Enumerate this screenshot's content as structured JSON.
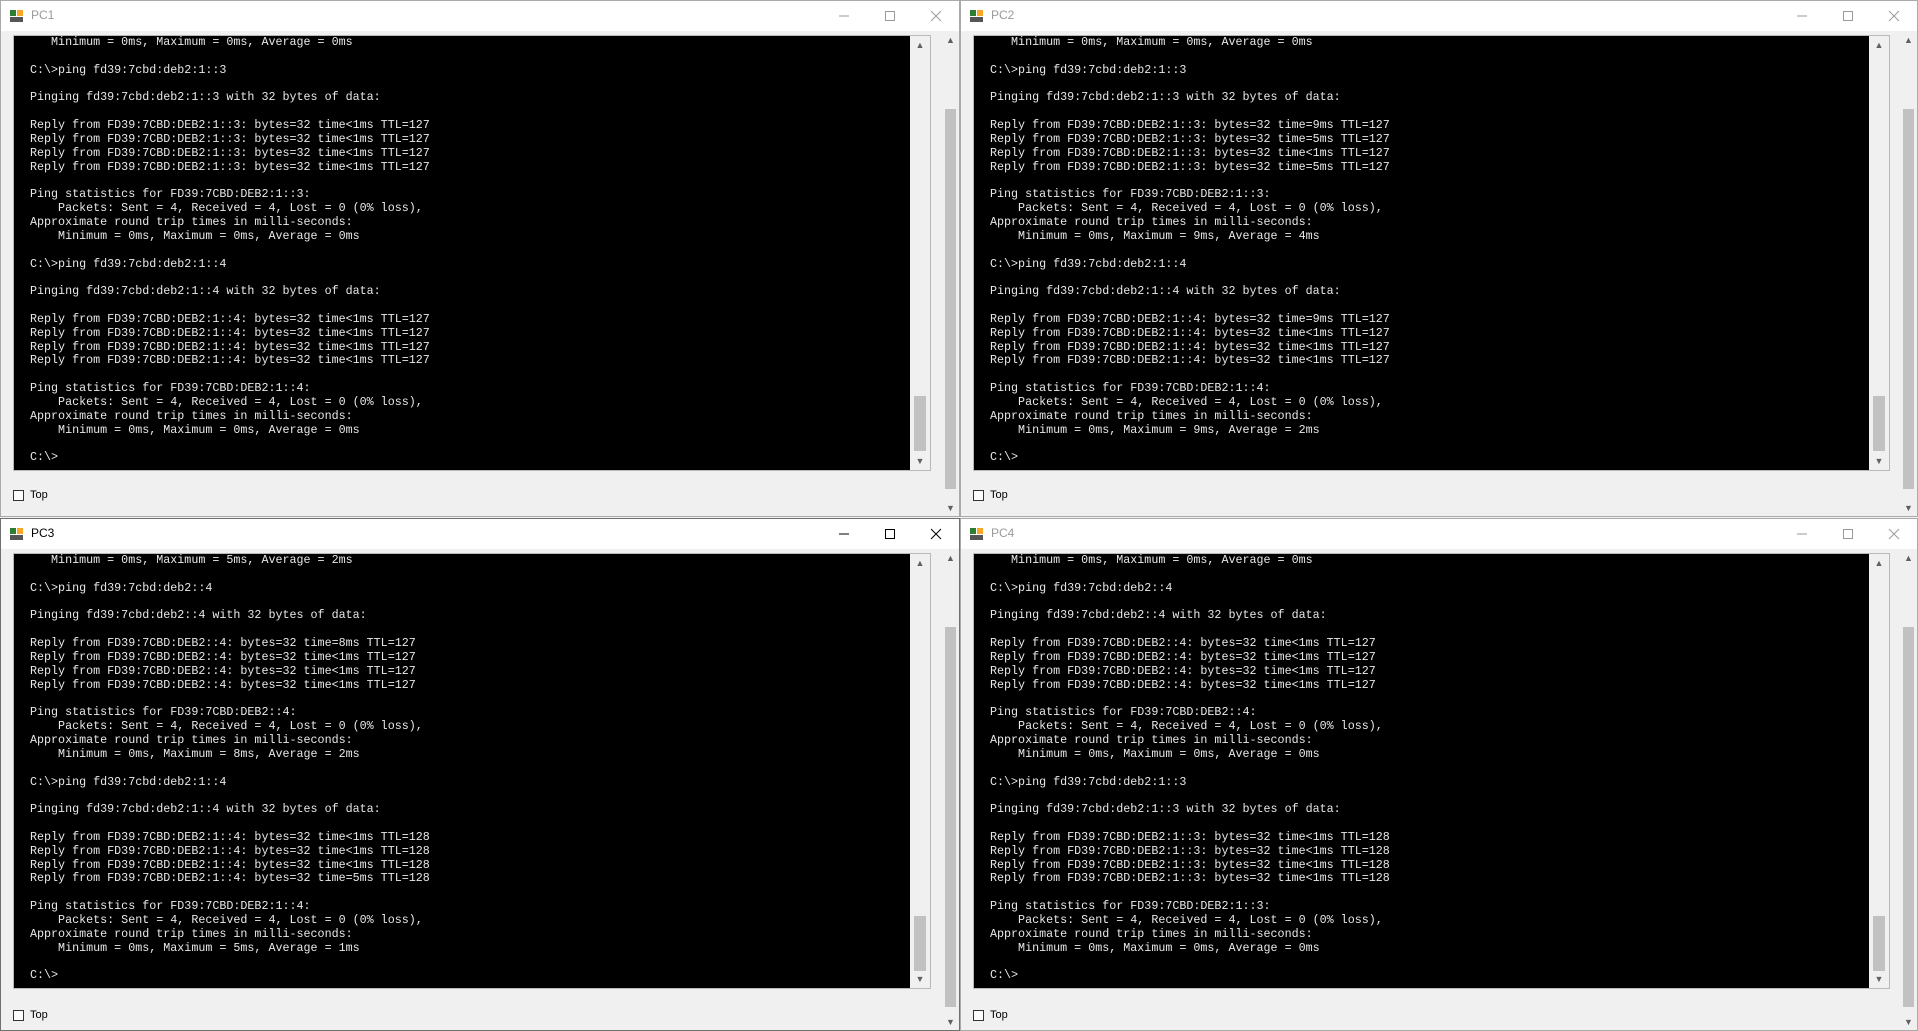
{
  "windows": [
    {
      "title": "PC1",
      "top_checkbox_label": "Top",
      "terminal_lines": [
        "   Minimum = 0ms, Maximum = 0ms, Average = 0ms",
        "",
        "C:\\>ping fd39:7cbd:deb2:1::3",
        "",
        "Pinging fd39:7cbd:deb2:1::3 with 32 bytes of data:",
        "",
        "Reply from FD39:7CBD:DEB2:1::3: bytes=32 time<1ms TTL=127",
        "Reply from FD39:7CBD:DEB2:1::3: bytes=32 time<1ms TTL=127",
        "Reply from FD39:7CBD:DEB2:1::3: bytes=32 time<1ms TTL=127",
        "Reply from FD39:7CBD:DEB2:1::3: bytes=32 time<1ms TTL=127",
        "",
        "Ping statistics for FD39:7CBD:DEB2:1::3:",
        "    Packets: Sent = 4, Received = 4, Lost = 0 (0% loss),",
        "Approximate round trip times in milli-seconds:",
        "    Minimum = 0ms, Maximum = 0ms, Average = 0ms",
        "",
        "C:\\>ping fd39:7cbd:deb2:1::4",
        "",
        "Pinging fd39:7cbd:deb2:1::4 with 32 bytes of data:",
        "",
        "Reply from FD39:7CBD:DEB2:1::4: bytes=32 time<1ms TTL=127",
        "Reply from FD39:7CBD:DEB2:1::4: bytes=32 time<1ms TTL=127",
        "Reply from FD39:7CBD:DEB2:1::4: bytes=32 time<1ms TTL=127",
        "Reply from FD39:7CBD:DEB2:1::4: bytes=32 time<1ms TTL=127",
        "",
        "Ping statistics for FD39:7CBD:DEB2:1::4:",
        "    Packets: Sent = 4, Received = 4, Lost = 0 (0% loss),",
        "Approximate round trip times in milli-seconds:",
        "    Minimum = 0ms, Maximum = 0ms, Average = 0ms",
        "",
        "C:\\>"
      ]
    },
    {
      "title": "PC2",
      "top_checkbox_label": "Top",
      "terminal_lines": [
        "   Minimum = 0ms, Maximum = 0ms, Average = 0ms",
        "",
        "C:\\>ping fd39:7cbd:deb2:1::3",
        "",
        "Pinging fd39:7cbd:deb2:1::3 with 32 bytes of data:",
        "",
        "Reply from FD39:7CBD:DEB2:1::3: bytes=32 time=9ms TTL=127",
        "Reply from FD39:7CBD:DEB2:1::3: bytes=32 time=5ms TTL=127",
        "Reply from FD39:7CBD:DEB2:1::3: bytes=32 time<1ms TTL=127",
        "Reply from FD39:7CBD:DEB2:1::3: bytes=32 time=5ms TTL=127",
        "",
        "Ping statistics for FD39:7CBD:DEB2:1::3:",
        "    Packets: Sent = 4, Received = 4, Lost = 0 (0% loss),",
        "Approximate round trip times in milli-seconds:",
        "    Minimum = 0ms, Maximum = 9ms, Average = 4ms",
        "",
        "C:\\>ping fd39:7cbd:deb2:1::4",
        "",
        "Pinging fd39:7cbd:deb2:1::4 with 32 bytes of data:",
        "",
        "Reply from FD39:7CBD:DEB2:1::4: bytes=32 time=9ms TTL=127",
        "Reply from FD39:7CBD:DEB2:1::4: bytes=32 time<1ms TTL=127",
        "Reply from FD39:7CBD:DEB2:1::4: bytes=32 time<1ms TTL=127",
        "Reply from FD39:7CBD:DEB2:1::4: bytes=32 time<1ms TTL=127",
        "",
        "Ping statistics for FD39:7CBD:DEB2:1::4:",
        "    Packets: Sent = 4, Received = 4, Lost = 0 (0% loss),",
        "Approximate round trip times in milli-seconds:",
        "    Minimum = 0ms, Maximum = 9ms, Average = 2ms",
        "",
        "C:\\>"
      ]
    },
    {
      "title": "PC3",
      "top_checkbox_label": "Top",
      "terminal_lines": [
        "   Minimum = 0ms, Maximum = 5ms, Average = 2ms",
        "",
        "C:\\>ping fd39:7cbd:deb2::4",
        "",
        "Pinging fd39:7cbd:deb2::4 with 32 bytes of data:",
        "",
        "Reply from FD39:7CBD:DEB2::4: bytes=32 time=8ms TTL=127",
        "Reply from FD39:7CBD:DEB2::4: bytes=32 time<1ms TTL=127",
        "Reply from FD39:7CBD:DEB2::4: bytes=32 time<1ms TTL=127",
        "Reply from FD39:7CBD:DEB2::4: bytes=32 time<1ms TTL=127",
        "",
        "Ping statistics for FD39:7CBD:DEB2::4:",
        "    Packets: Sent = 4, Received = 4, Lost = 0 (0% loss),",
        "Approximate round trip times in milli-seconds:",
        "    Minimum = 0ms, Maximum = 8ms, Average = 2ms",
        "",
        "C:\\>ping fd39:7cbd:deb2:1::4",
        "",
        "Pinging fd39:7cbd:deb2:1::4 with 32 bytes of data:",
        "",
        "Reply from FD39:7CBD:DEB2:1::4: bytes=32 time<1ms TTL=128",
        "Reply from FD39:7CBD:DEB2:1::4: bytes=32 time<1ms TTL=128",
        "Reply from FD39:7CBD:DEB2:1::4: bytes=32 time<1ms TTL=128",
        "Reply from FD39:7CBD:DEB2:1::4: bytes=32 time=5ms TTL=128",
        "",
        "Ping statistics for FD39:7CBD:DEB2:1::4:",
        "    Packets: Sent = 4, Received = 4, Lost = 0 (0% loss),",
        "Approximate round trip times in milli-seconds:",
        "    Minimum = 0ms, Maximum = 5ms, Average = 1ms",
        "",
        "C:\\>"
      ]
    },
    {
      "title": "PC4",
      "top_checkbox_label": "Top",
      "terminal_lines": [
        "   Minimum = 0ms, Maximum = 0ms, Average = 0ms",
        "",
        "C:\\>ping fd39:7cbd:deb2::4",
        "",
        "Pinging fd39:7cbd:deb2::4 with 32 bytes of data:",
        "",
        "Reply from FD39:7CBD:DEB2::4: bytes=32 time<1ms TTL=127",
        "Reply from FD39:7CBD:DEB2::4: bytes=32 time<1ms TTL=127",
        "Reply from FD39:7CBD:DEB2::4: bytes=32 time<1ms TTL=127",
        "Reply from FD39:7CBD:DEB2::4: bytes=32 time<1ms TTL=127",
        "",
        "Ping statistics for FD39:7CBD:DEB2::4:",
        "    Packets: Sent = 4, Received = 4, Lost = 0 (0% loss),",
        "Approximate round trip times in milli-seconds:",
        "    Minimum = 0ms, Maximum = 0ms, Average = 0ms",
        "",
        "C:\\>ping fd39:7cbd:deb2:1::3",
        "",
        "Pinging fd39:7cbd:deb2:1::3 with 32 bytes of data:",
        "",
        "Reply from FD39:7CBD:DEB2:1::3: bytes=32 time<1ms TTL=128",
        "Reply from FD39:7CBD:DEB2:1::3: bytes=32 time<1ms TTL=128",
        "Reply from FD39:7CBD:DEB2:1::3: bytes=32 time<1ms TTL=128",
        "Reply from FD39:7CBD:DEB2:1::3: bytes=32 time<1ms TTL=128",
        "",
        "Ping statistics for FD39:7CBD:DEB2:1::3:",
        "    Packets: Sent = 4, Received = 4, Lost = 0 (0% loss),",
        "Approximate round trip times in milli-seconds:",
        "    Minimum = 0ms, Maximum = 0ms, Average = 0ms",
        "",
        "C:\\>"
      ]
    }
  ],
  "colors": {
    "terminal_bg": "#000000",
    "terminal_fg": "#e8e8e8",
    "titlebar_bg": "#ffffff",
    "window_bg": "#f0f0f0",
    "icon_green": "#2e7d32",
    "icon_yellow": "#f9a825"
  },
  "icons": {
    "app": "packet-tracer-pc-icon",
    "minimize": "minimize-icon",
    "maximize": "maximize-icon",
    "close": "close-icon"
  }
}
